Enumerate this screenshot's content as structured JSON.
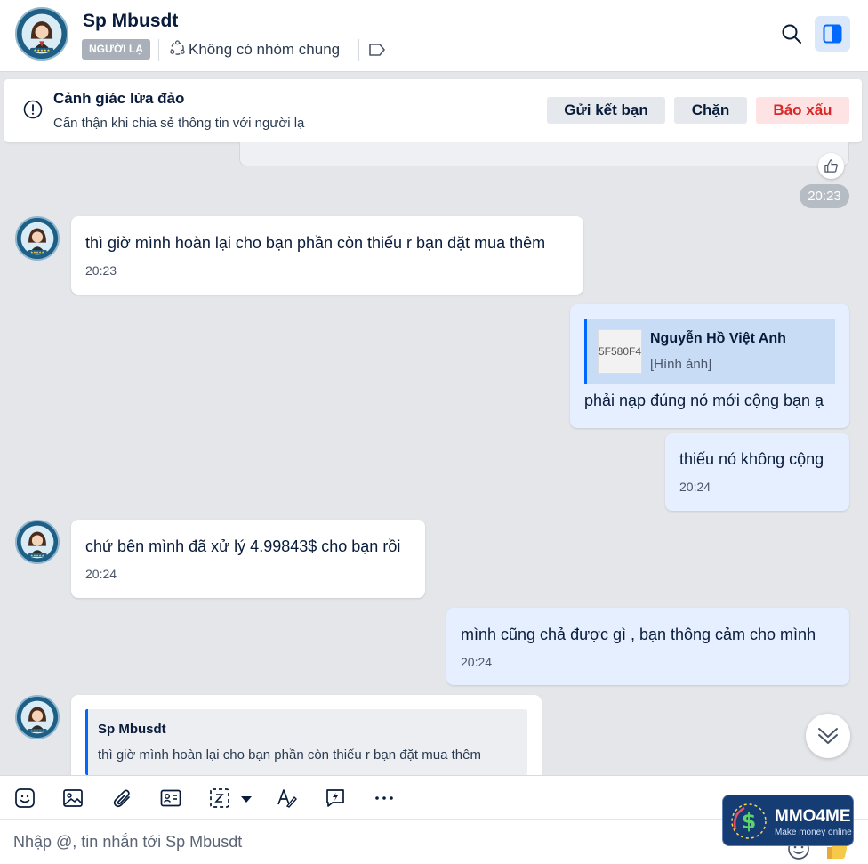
{
  "header": {
    "contact_name": "Sp Mbusdt",
    "stranger_badge": "NGƯỜI LẠ",
    "mutual_groups": "Không có nhóm chung",
    "icons": [
      "group-icon",
      "tag-icon",
      "search-icon",
      "side-panel-icon"
    ]
  },
  "warning": {
    "title": "Cảnh giác lừa đảo",
    "subtitle": "Cẩn thận khi chia sẻ thông tin với người lạ",
    "add_friend_label": "Gửi kết bạn",
    "block_label": "Chặn",
    "report_label": "Báo xấu"
  },
  "chat": {
    "previous_time": "20:23",
    "messages": [
      {
        "sender": "them",
        "text": "thì giờ mình hoàn lại cho bạn phần còn thiếu r bạn đặt mua thêm",
        "time": "20:23"
      },
      {
        "sender": "me",
        "quote_name": "Nguyễn Hồ Việt Anh",
        "quote_text": "[Hình ảnh]",
        "quote_thumb_text": "5F580F48",
        "text": "phải nạp đúng nó mới cộng bạn ạ"
      },
      {
        "sender": "me",
        "text": "thiếu nó không cộng",
        "time": "20:24"
      },
      {
        "sender": "them",
        "text": "chứ bên mình đã xử lý 4.99843$ cho bạn rồi",
        "time": "20:24"
      },
      {
        "sender": "me",
        "text": "mình cũng chả được gì  , bạn thông cảm cho mình",
        "time": "20:24"
      },
      {
        "sender": "them",
        "quote_name": "Sp Mbusdt",
        "quote_text": "thì giờ mình hoàn lại cho bạn phần còn thiếu r bạn đặt mua thêm"
      }
    ]
  },
  "toolbar": {
    "icons": [
      "sticker-icon",
      "image-icon",
      "attachment-icon",
      "contact-card-icon",
      "screenshot-icon",
      "format-text-icon",
      "quick-message-icon",
      "more-icon"
    ]
  },
  "composer": {
    "placeholder": "Nhập @, tin nhắn tới Sp Mbusdt"
  },
  "watermark": {
    "title": "MMO4ME",
    "subtitle": "Make money online"
  },
  "colors": {
    "accent": "#0068ff",
    "own_bubble": "#e5efff",
    "background": "#e4e6ea",
    "report": "#dc2626"
  }
}
